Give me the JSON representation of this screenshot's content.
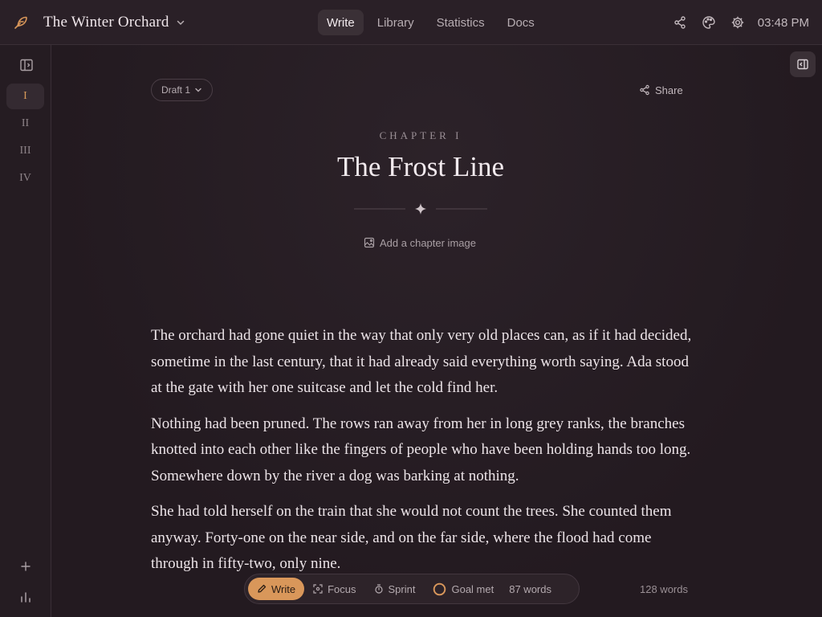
{
  "app": {
    "book_title": "The Winter Orchard",
    "accent_color": "#d9975a"
  },
  "nav": {
    "tabs": [
      {
        "label": "Write",
        "active": true
      },
      {
        "label": "Library",
        "active": false
      },
      {
        "label": "Statistics",
        "active": false
      },
      {
        "label": "Docs",
        "active": false
      }
    ]
  },
  "header": {
    "time": "03:48 PM",
    "icons": [
      "share-icon",
      "palette-icon",
      "gear-icon"
    ]
  },
  "sidebar": {
    "chapters": [
      {
        "label": "I",
        "active": true
      },
      {
        "label": "II",
        "active": false
      },
      {
        "label": "III",
        "active": false
      },
      {
        "label": "IV",
        "active": false
      }
    ]
  },
  "editor": {
    "draft_label": "Draft 1",
    "share_label": "Share",
    "chapter_label": "CHAPTER I",
    "chapter_title": "The Frost Line",
    "add_image_label": "Add a chapter image",
    "paragraphs": [
      "The orchard had gone quiet in the way that only very old places can, as if it had decided, sometime in the last century, that it had already said everything worth saying. Ada stood at the gate with her one suitcase and let the cold find her.",
      "Nothing had been pruned. The rows ran away from her in long grey ranks, the branches knotted into each other like the fingers of people who have been holding hands too long. Somewhere down by the river a dog was barking at nothing.",
      "She had told herself on the train that she would not count the trees. She counted them anyway. Forty-one on the near side, and on the far side, where the flood had come through in fifty-two, only nine."
    ]
  },
  "statusbar": {
    "write_label": "Write",
    "focus_label": "Focus",
    "sprint_label": "Sprint",
    "goal_label": "Goal met",
    "goal_progress": 1.0,
    "session_words": "87 words",
    "total_words": "128 words"
  }
}
